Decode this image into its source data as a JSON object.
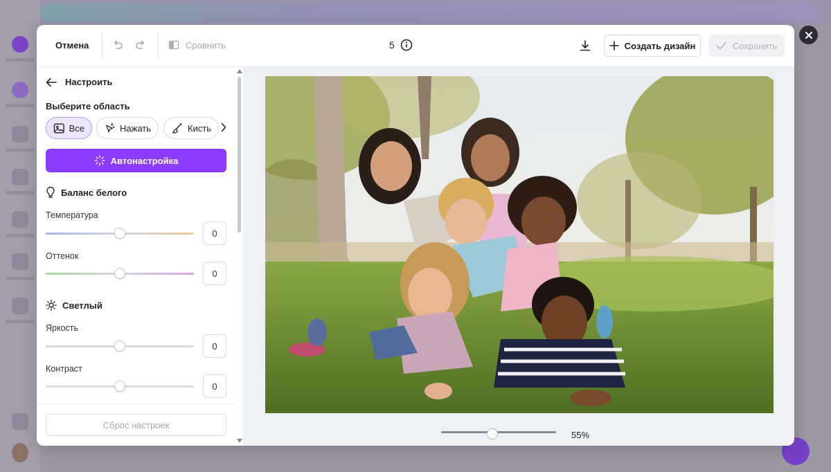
{
  "toolbar": {
    "cancel_label": "Отмена",
    "compare_label": "Сравнить",
    "count": "5",
    "create_design_label": "Создать дизайн",
    "save_label": "Сохранить"
  },
  "panel": {
    "back_title": "Настроить",
    "select_area_label": "Выберите область",
    "area_chips": [
      {
        "label": "Все",
        "icon": "image-icon",
        "active": true
      },
      {
        "label": "Нажать",
        "icon": "sparkle-pointer-icon",
        "active": false
      },
      {
        "label": "Кисть",
        "icon": "brush-icon",
        "active": false
      }
    ],
    "auto_label": "Автонастройка",
    "white_balance": {
      "title": "Баланс белого",
      "icon": "lightbulb-icon",
      "sliders": [
        {
          "label": "Температура",
          "value": "0"
        },
        {
          "label": "Оттенок",
          "value": "0"
        }
      ]
    },
    "light": {
      "title": "Светлый",
      "icon": "sun-icon",
      "sliders": [
        {
          "label": "Яркость",
          "value": "0"
        },
        {
          "label": "Контраст",
          "value": "0"
        }
      ]
    },
    "reset_label": "Сброс настроек"
  },
  "canvas": {
    "zoom": "55%"
  },
  "colors": {
    "accent": "#8b3dff",
    "chip_active_bg": "#ece6fb"
  }
}
